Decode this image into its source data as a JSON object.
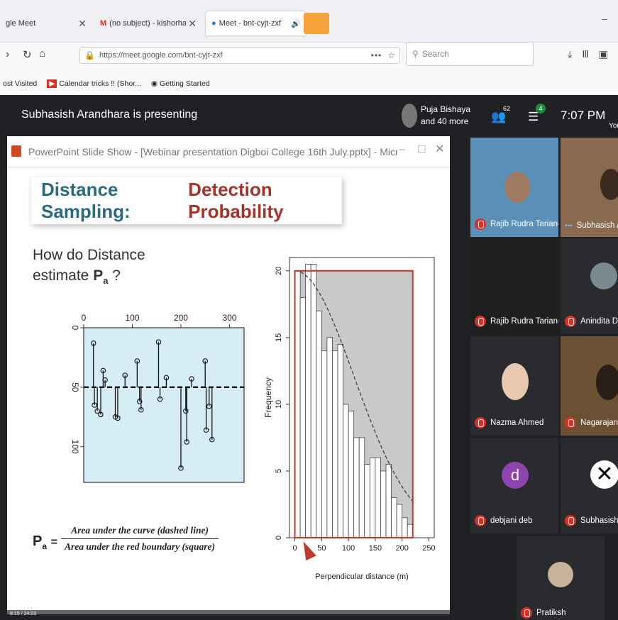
{
  "browser": {
    "tabs": [
      {
        "label": "gle Meet",
        "icon": "meet-icon"
      },
      {
        "label": "(no subject) - kishorhaloi@gm",
        "icon": "gmail-icon"
      },
      {
        "label": "Meet - bnt-cyjt-zxf",
        "icon": "meet-pin-icon"
      }
    ],
    "url": "https://meet.google.com/bnt-cyjt-zxf",
    "url_domain": "meet.google.com",
    "search_placeholder": "Search",
    "bookmarks": [
      "ost Visited",
      "Calendar tricks !! (Shor...",
      "Getting Started"
    ],
    "page_actions": "•••"
  },
  "meet": {
    "presenting": "Subhasish Arandhara is presenting",
    "presenter_name": "Puja Bishaya",
    "presenter_more": "and 40 more",
    "people_count": "62",
    "chat_count": "4",
    "time": "7:07 PM",
    "you_label": "You",
    "participants": [
      {
        "name": "Rajib Rudra Tariang P..."
      },
      {
        "name": "Subhasish A"
      },
      {
        "name": "Rajib Rudra Tariang P..."
      },
      {
        "name": "Anindita Dey"
      },
      {
        "name": "Nazma Ahmed"
      },
      {
        "name": "Nagarajan B"
      },
      {
        "name": "debjani deb",
        "initial": "d"
      },
      {
        "name": "Subhasish A"
      },
      {
        "name": "Pratiksh"
      }
    ]
  },
  "ppt": {
    "window_title": "PowerPoint Slide Show - [Webinar presentation Digboi College 16th July.pptx] - Microsoft...",
    "title_part1": "Distance Sampling: ",
    "title_part2": "Detection Probability",
    "question_line1": "How do Distance",
    "question_line2": "estimate ",
    "question_symbol": "P",
    "question_sub": "a",
    "question_end": " ?",
    "formula_lhs": "P",
    "formula_sub": "a",
    "formula_eq": "=",
    "formula_num": "Area under the curve (dashed line)",
    "formula_den": "Area under the red boundary (square)",
    "status": "8:15 / 24:23",
    "colors": {
      "title1": "#2b6b7f",
      "title2": "#a83229",
      "red": "#c0392b"
    }
  },
  "chart_data": [
    {
      "type": "scatter",
      "x_ticks": [
        "0",
        "100",
        "200",
        "300"
      ],
      "y_ticks": [
        "0",
        "50",
        "100"
      ],
      "xlim": [
        0,
        330
      ],
      "ylim": [
        0,
        130
      ],
      "line_y": 50,
      "points": [
        {
          "x": 20,
          "y": 13,
          "y2": 50
        },
        {
          "x": 28,
          "y": 70,
          "y2": 50
        },
        {
          "x": 22,
          "y": 65,
          "y2": 50
        },
        {
          "x": 40,
          "y": 36,
          "y2": 50
        },
        {
          "x": 35,
          "y": 73,
          "y2": 50
        },
        {
          "x": 44,
          "y": 44,
          "y2": 50
        },
        {
          "x": 65,
          "y": 75,
          "y2": 50
        },
        {
          "x": 70,
          "y": 76,
          "y2": 50
        },
        {
          "x": 85,
          "y": 40,
          "y2": 50
        },
        {
          "x": 110,
          "y": 28,
          "y2": 50
        },
        {
          "x": 115,
          "y": 62,
          "y2": 50
        },
        {
          "x": 118,
          "y": 69,
          "y2": 50
        },
        {
          "x": 154,
          "y": 12,
          "y2": 50
        },
        {
          "x": 157,
          "y": 60,
          "y2": 50
        },
        {
          "x": 170,
          "y": 42,
          "y2": 50
        },
        {
          "x": 200,
          "y": 118,
          "y2": 50
        },
        {
          "x": 210,
          "y": 70,
          "y2": 50
        },
        {
          "x": 212,
          "y": 96,
          "y2": 50
        },
        {
          "x": 222,
          "y": 43,
          "y2": 50
        },
        {
          "x": 250,
          "y": 28,
          "y2": 50
        },
        {
          "x": 252,
          "y": 86,
          "y2": 50
        },
        {
          "x": 258,
          "y": 66,
          "y2": 50
        },
        {
          "x": 264,
          "y": 94,
          "y2": 50
        }
      ]
    },
    {
      "type": "bar",
      "xlabel": "Perpendicular distance (m)",
      "ylabel": "Frequency",
      "x_ticks": [
        "0",
        "50",
        "100",
        "150",
        "200",
        "250"
      ],
      "y_ticks": [
        "0",
        "5",
        "10",
        "15",
        "20"
      ],
      "xlim": [
        -10,
        260
      ],
      "ylim": [
        0,
        21
      ],
      "bin_width": 10,
      "values": [
        20,
        18,
        20.5,
        20.5,
        17,
        14,
        15,
        14,
        14.5,
        10,
        9.5,
        7.5,
        7.5,
        5.5,
        6,
        6,
        5,
        5.5,
        3,
        2.5,
        1.5,
        1
      ],
      "red_line": 20,
      "curve": "half-normal"
    }
  ]
}
